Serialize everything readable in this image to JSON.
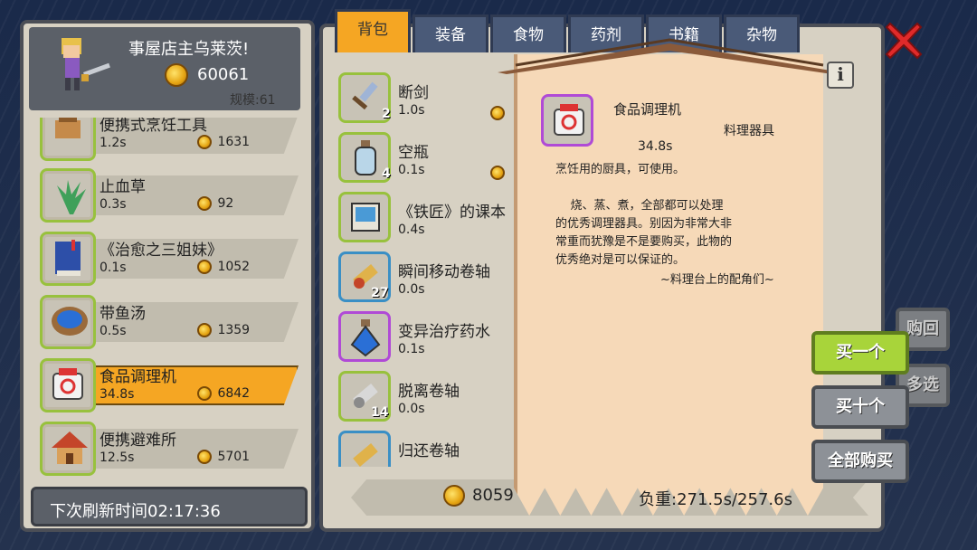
{
  "shop": {
    "owner_name": "事屋店主乌莱茨!",
    "gold": "60061",
    "scale": "规模:61",
    "refresh": "下次刷新时间02:17:36",
    "items": [
      {
        "name": "便携式烹饪工具",
        "time": "1.2s",
        "price": "1631",
        "icon": "cooking-tool-icon"
      },
      {
        "name": "止血草",
        "time": "0.3s",
        "price": "92",
        "icon": "herb-icon"
      },
      {
        "name": "《治愈之三姐妹》",
        "time": "0.1s",
        "price": "1052",
        "icon": "book-icon"
      },
      {
        "name": "带鱼汤",
        "time": "0.5s",
        "price": "1359",
        "icon": "soup-pot-icon"
      },
      {
        "name": "食品调理机",
        "time": "34.8s",
        "price": "6842",
        "icon": "food-processor-icon"
      },
      {
        "name": "便携避难所",
        "time": "12.5s",
        "price": "5701",
        "icon": "shelter-icon"
      }
    ]
  },
  "tabs": [
    "背包",
    "装备",
    "食物",
    "药剂",
    "书籍",
    "杂物"
  ],
  "inventory": [
    {
      "name": "断剑",
      "time": "1.0s",
      "count": "2",
      "icon": "broken-sword-icon"
    },
    {
      "name": "空瓶",
      "time": "0.1s",
      "count": "4",
      "icon": "empty-bottle-icon"
    },
    {
      "name": "《铁匠》的课本",
      "time": "0.4s",
      "count": "",
      "icon": "textbook-icon"
    },
    {
      "name": "瞬间移动卷轴",
      "time": "0.0s",
      "count": "27",
      "icon": "teleport-scroll-icon"
    },
    {
      "name": "变异治疗药水",
      "time": "0.1s",
      "count": "",
      "icon": "potion-icon"
    },
    {
      "name": "脱离卷轴",
      "time": "0.0s",
      "count": "14",
      "icon": "escape-scroll-icon"
    },
    {
      "name": "归还卷轴",
      "time": "",
      "count": "",
      "icon": "return-scroll-icon"
    }
  ],
  "footer": {
    "gold": "8059",
    "weight": "负重:271.5s/257.6s"
  },
  "detail": {
    "name": "食品调理机",
    "category": "料理器具",
    "time": "34.8s",
    "description": "烹饪用的厨具，可使用。\n\n    烧、蒸、煮，全部都可以处理\n的优秀调理器具。别因为非常大非\n常重而犹豫是不是要购买，此物的\n优秀绝对是可以保证的。",
    "signature": "~料理台上的配角们~"
  },
  "buttons": {
    "buy_one": "买一个",
    "buy_ten": "买十个",
    "buy_all": "全部购买",
    "buyback": "购回",
    "multi": "多选"
  },
  "colors": {
    "accent": "#f5a623",
    "selected_button": "#a8d43a",
    "tab": "#4a5a78",
    "panel": "#d7d1c3"
  }
}
